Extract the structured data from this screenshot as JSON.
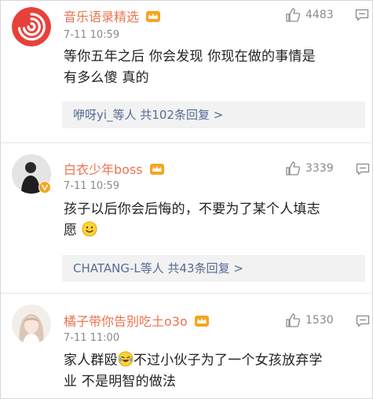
{
  "comments": [
    {
      "username": "音乐语录精选",
      "time": "7-11 10:59",
      "likes": "4483",
      "text_line1": "等你五年之后 你会发现 你现在做的事情是",
      "text_line2": "有多么傻 真的",
      "reply_summary": "咿呀yi_等人 共102条回复 >"
    },
    {
      "username": "白衣少年boss",
      "time": "7-11 10:59",
      "likes": "3339",
      "text_line1": "孩子以后你会后悔的，不要为了某个人填志",
      "text_line2": "愿",
      "reply_summary": "CHATANG-L等人 共43条回复 >"
    },
    {
      "username": "橘子带你告别吃土o3o",
      "time": "7-11 11:00",
      "likes": "1530",
      "text_line1_a": "家人群殴",
      "text_line1_b": "不过小伙子为了一个女孩放弃学",
      "text_line2": "业 不是明智的做法"
    }
  ],
  "colors": {
    "username": "#eb7350",
    "reply_link": "#576b95",
    "meta": "#8a8a8a"
  },
  "icons": [
    "spiral-logo-icon",
    "vip-crown-icon",
    "thumbs-up-icon",
    "comment-bubble-icon",
    "smile-emoji-icon",
    "laugh-cry-emoji-icon"
  ]
}
